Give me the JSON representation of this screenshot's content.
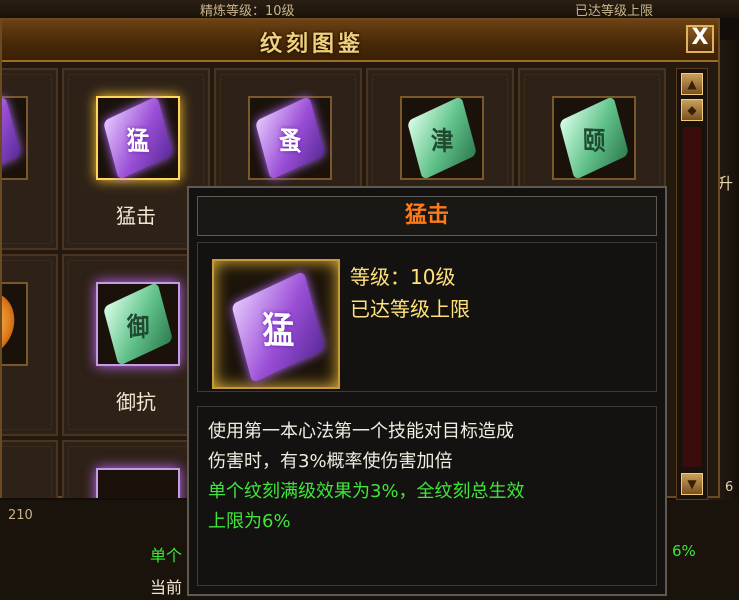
{
  "background": {
    "top_left_text": "精炼等级：10级",
    "top_right_text": "已达等级上限",
    "right_char": "升",
    "bottom_left_number": "210",
    "bottom_label_1": "单个",
    "bottom_label_2": "当前",
    "bottom_right_pct": "6%",
    "bottom_right_num": "6"
  },
  "window": {
    "title": "纹刻图鉴",
    "close_label": "X"
  },
  "grid": {
    "cells": [
      {
        "name": "",
        "glyph": "",
        "color": "purple"
      },
      {
        "name": "猛击",
        "glyph": "猛",
        "color": "purple"
      },
      {
        "name": "",
        "glyph": "蚤",
        "color": "purple"
      },
      {
        "name": "",
        "glyph": "津",
        "color": "green"
      },
      {
        "name": "",
        "glyph": "颐",
        "color": "green"
      },
      {
        "name": "",
        "glyph": "",
        "color": "orange"
      },
      {
        "name": "御抗",
        "glyph": "御",
        "color": "green"
      }
    ]
  },
  "tooltip": {
    "title": "猛击",
    "icon_glyph": "猛",
    "level": "等级：10级",
    "max_level": "已达等级上限",
    "desc_line1": "使用第一本心法第一个技能对目标造成",
    "desc_line2": "伤害时，有3%概率使伤害加倍",
    "bonus_line1": "单个纹刻满级效果为3%，全纹刻总生效",
    "bonus_line2": "上限为6%"
  },
  "colors": {
    "title_gold": "#f1cf7c",
    "tooltip_title": "#ff7a18",
    "level_yellow": "#ffe37a",
    "bonus_green": "#3ee63a"
  }
}
